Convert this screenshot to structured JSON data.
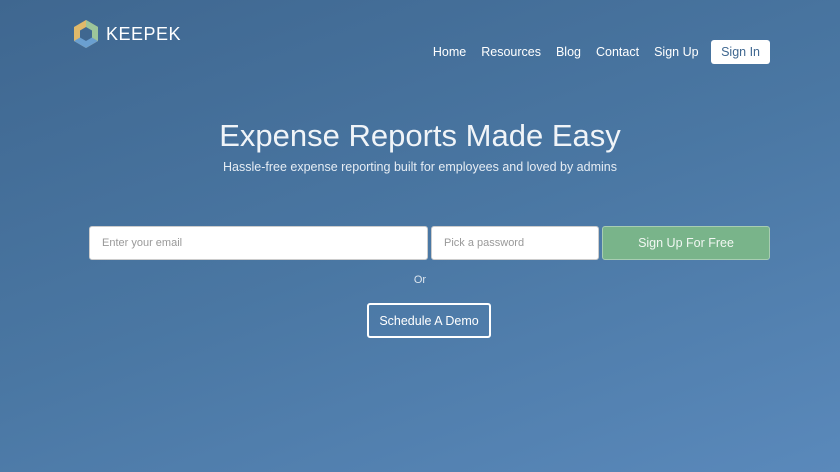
{
  "brand": {
    "name": "KEEPEK"
  },
  "nav": {
    "items": [
      "Home",
      "Resources",
      "Blog",
      "Contact",
      "Sign Up"
    ],
    "sign_in": "Sign In"
  },
  "hero": {
    "title": "Expense Reports Made Easy",
    "subtitle": "Hassle-free expense reporting built for employees and loved by admins"
  },
  "form": {
    "email_placeholder": "Enter your email",
    "password_placeholder": "Pick a password",
    "submit": "Sign Up For Free",
    "or": "Or",
    "demo": "Schedule A Demo"
  },
  "colors": {
    "cta": "#79b48a"
  }
}
